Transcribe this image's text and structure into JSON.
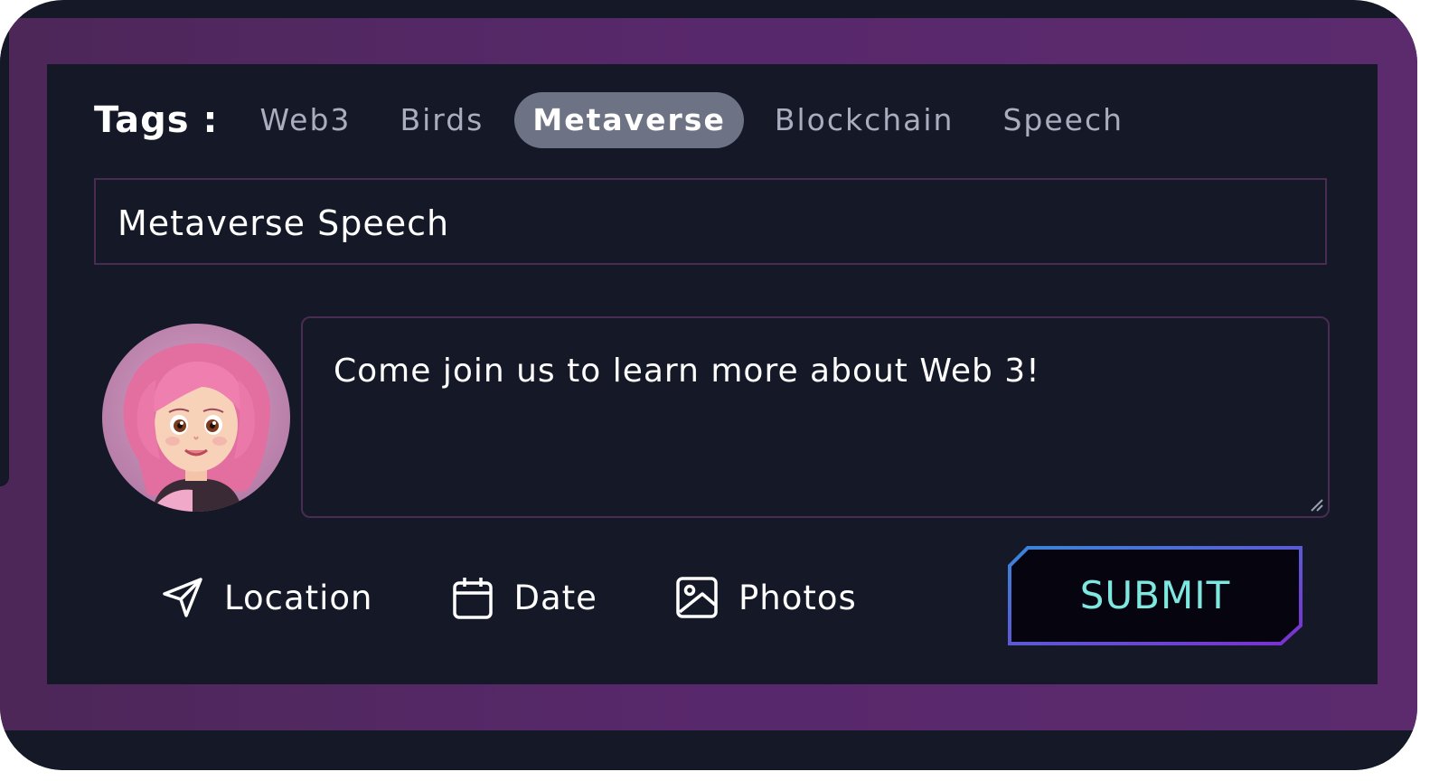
{
  "tags": {
    "label": "Tags :",
    "items": [
      {
        "label": "Web3",
        "active": false
      },
      {
        "label": "Birds",
        "active": false
      },
      {
        "label": "Metaverse",
        "active": true
      },
      {
        "label": "Blockchain",
        "active": false
      },
      {
        "label": "Speech",
        "active": false
      }
    ]
  },
  "title_input": {
    "value": "Metaverse Speech"
  },
  "message": {
    "value": "Come join us to learn more about Web 3!"
  },
  "actions": {
    "location_label": "Location",
    "date_label": "Date",
    "photos_label": "Photos"
  },
  "submit": {
    "label": "SUBMIT"
  },
  "colors": {
    "background": "#141827",
    "frame": "#58286c",
    "active_tag": "#6d7384",
    "submit_text": "#7ee8e0",
    "submit_border_start": "#3a86d8",
    "submit_border_end": "#7b2fd0"
  },
  "icons": [
    "location-arrow-icon",
    "calendar-icon",
    "image-icon",
    "resize-grip-icon"
  ]
}
